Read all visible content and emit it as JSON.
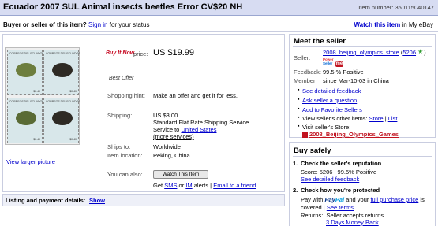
{
  "title": "Ecuador 2007 SUL Animal insects beetles Error CV$20 NH",
  "item_number": "Item number: 350115040147",
  "status": {
    "prefix": "Buyer or seller of this item?",
    "sign_in": "Sign in",
    "suffix": "for your status",
    "watch": "Watch this item",
    "watch_suffix": "in My eBay"
  },
  "listing": {
    "stamp_header": "CORREOS DEL ECUADOR",
    "stamp_value": "$0.40",
    "view_larger": "View larger picture",
    "buy_now": "Buy It Now",
    "price_label": "price:",
    "price": "US $19.99",
    "best_offer": "Best Offer",
    "rows": {
      "shopping_hint_label": "Shopping hint:",
      "shopping_hint": "Make an offer and get it for less.",
      "shipping_label": "Shipping:",
      "shipping_cost": "US $3.00",
      "shipping_service": "Standard Flat Rate Shipping Service",
      "service_to": "Service to",
      "service_to_link": "United States",
      "more_services": "(more services)",
      "ships_to_label": "Ships to:",
      "ships_to": "Worldwide",
      "location_label": "Item location:",
      "location": "Peking, China",
      "also_label": "You can also:"
    },
    "watch_button": "Watch This Item",
    "alerts": {
      "get": "Get",
      "sms": "SMS",
      "or": "or",
      "im": "IM",
      "alerts_text": "alerts |",
      "email": "Email to a friend"
    }
  },
  "listing_details": {
    "label": "Listing and payment details:",
    "show": "Show"
  },
  "seller": {
    "heading": "Meet the seller",
    "seller_label": "Seller:",
    "seller_name": "2008_beijing_olympics_store",
    "feedback_count": "5206",
    "power": "Power",
    "power_seller": "Seller",
    "me": "me",
    "feedback_label": "Feedback:",
    "feedback_value": "99.5 % Positive",
    "member_label": "Member:",
    "member_value": "since Mar-10-03 in China",
    "links": {
      "detailed_feedback": "See detailed feedback",
      "ask_question": "Ask seller a question",
      "add_favorite": "Add to Favorite Sellers",
      "other_items": "View seller's other items:",
      "store": "Store",
      "list": "List",
      "visit_store": "Visit seller's Store:",
      "store_name": "2008_Beijing_Olympics_Games"
    }
  },
  "buy_safely": {
    "heading": "Buy safely",
    "step1_num": "1.",
    "step1_title": "Check the seller's reputation",
    "score": "Score: 5206 | 99.5% Positive",
    "score_link": "See detailed feedback",
    "step2_num": "2.",
    "step2_title": "Check how you're protected",
    "pay_with": "Pay with",
    "paypal_pay": "Pay",
    "paypal_pal": "Pal",
    "pay_rest": "and your",
    "full_purchase": "full purchase price",
    "is": "is",
    "covered": "covered |",
    "see_terms": "See terms",
    "returns_label": "Returns:",
    "returns_value": "Seller accepts returns.",
    "money_back": "3 Days Money Back"
  },
  "colors": {
    "title_bar": "#d7dcf2",
    "link": "#0000cc",
    "buy_now": "#c4001a",
    "panel_border": "#c9cde0",
    "paypal_dark": "#003087",
    "paypal_light": "#009cde"
  },
  "icons": [
    "star-icon",
    "power-seller-badge",
    "me-icon",
    "store-icon"
  ]
}
